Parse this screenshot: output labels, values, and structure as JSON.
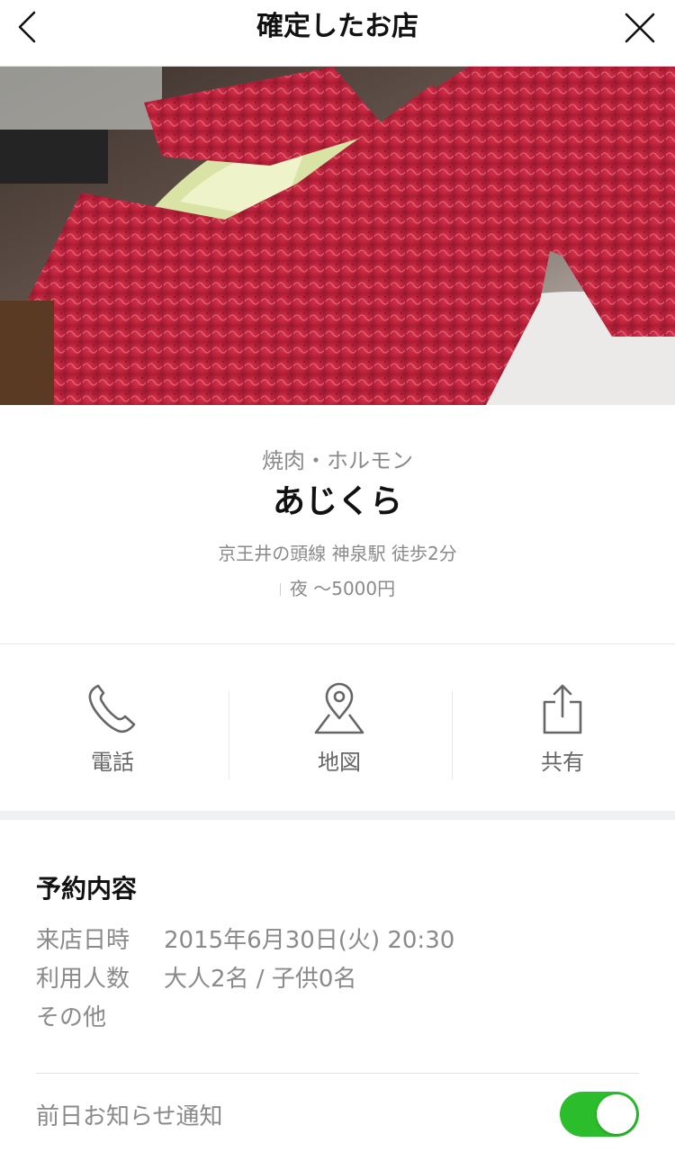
{
  "header": {
    "title": "確定したお店",
    "back_icon": "chevron-left-icon",
    "close_icon": "close-icon"
  },
  "hero": {
    "description_icon": "restaurant-photo"
  },
  "restaurant": {
    "genre": "焼肉・ホルモン",
    "name": "あじくら",
    "access": "京王井の頭線 神泉駅 徒歩2分",
    "price": "夜 〜5000円"
  },
  "actions": [
    {
      "label": "電話",
      "icon": "phone-icon"
    },
    {
      "label": "地図",
      "icon": "map-pin-icon"
    },
    {
      "label": "共有",
      "icon": "share-icon"
    }
  ],
  "reservation": {
    "title": "予約内容",
    "rows": [
      {
        "key": "来店日時",
        "value": "2015年6月30日(火) 20:30"
      },
      {
        "key": "利用人数",
        "value": "大人2名 / 子供0名"
      },
      {
        "key": "その他",
        "value": ""
      }
    ],
    "notify_label": "前日お知らせ通知",
    "notify_on": true
  },
  "colors": {
    "toggle_on": "#2bbd2b",
    "divider": "#e6e6e6",
    "muted_text": "#8a8a8a"
  }
}
